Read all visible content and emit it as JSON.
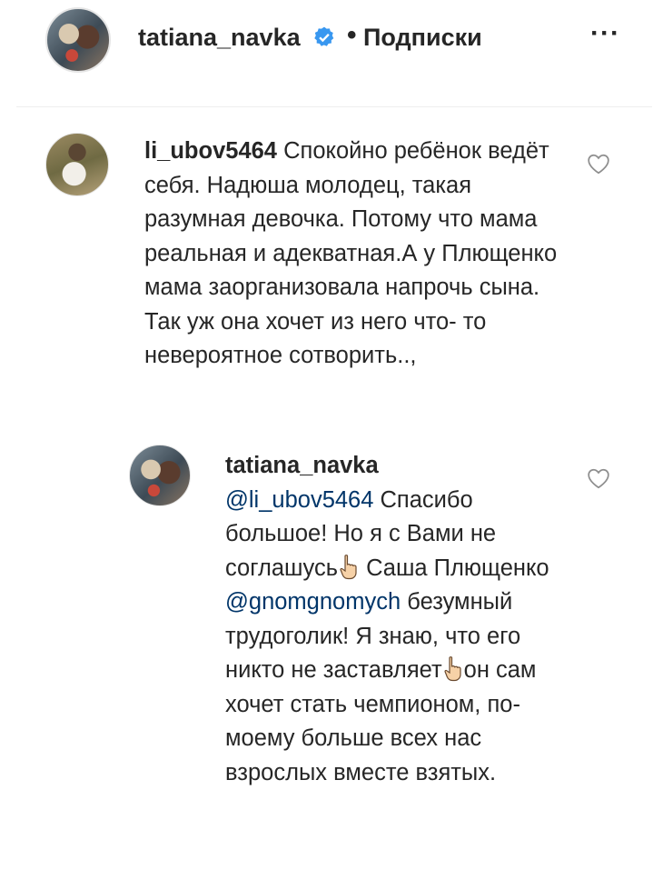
{
  "header": {
    "username": "tatiana_navka",
    "separator": "•",
    "follow_label": "Подписки",
    "more_label": "···"
  },
  "comments": [
    {
      "username": "li_ubov5464",
      "text": "Спокойно ребёнок ведёт себя. Надюша молодец, такая разумная девочка. Потому что мама реальная и адекватная.А у Плющенко мама заорганизовала напрочь сына. Так уж она хочет из него что- то невероятное сотворить..,"
    }
  ],
  "reply": {
    "username": "tatiana_navka",
    "mention_1": "@li_ubov5464",
    "text_1": "Спасибо большое! Но я с Вами не соглашусь",
    "text_2": "Саша Плющенко",
    "mention_2": "@gnomgnomych",
    "text_3": "безумный трудоголик! Я знаю, что его никто не заставляет",
    "text_4": "он сам хочет стать чемпионом, по-моему больше всех нас взрослых вместе взятых."
  },
  "colors": {
    "verified": "#3897f0",
    "mention": "#003569",
    "text": "#262626"
  },
  "icons": {
    "verified": "verified-badge-icon",
    "heart": "heart-outline-icon",
    "hand": "pointing-hand-emoji-icon"
  }
}
